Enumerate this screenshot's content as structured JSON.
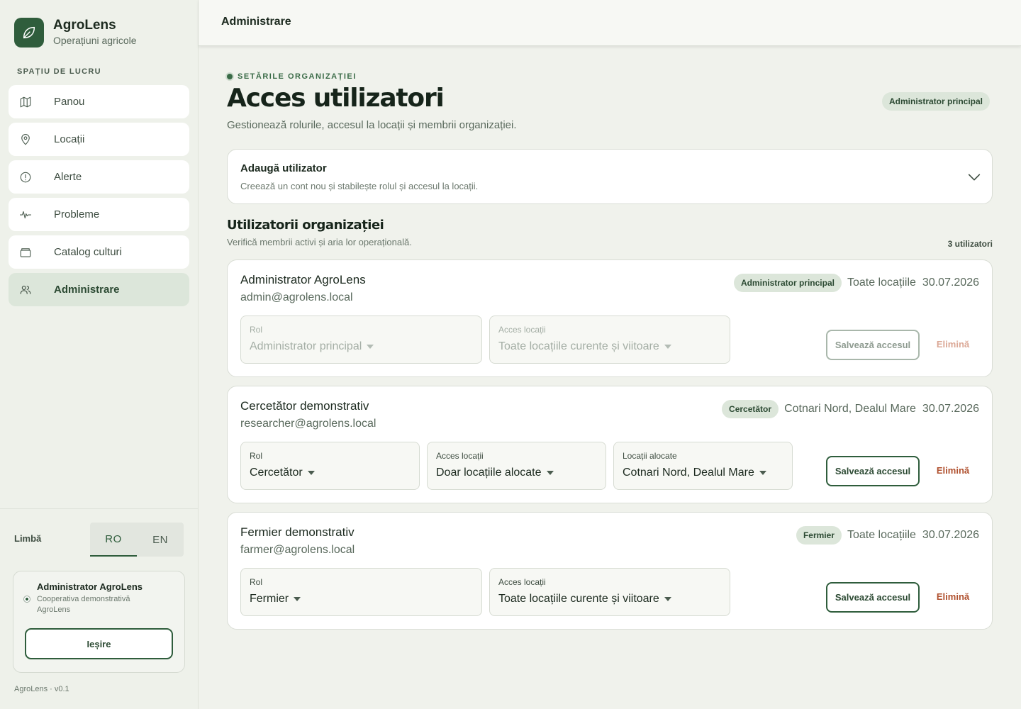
{
  "app": {
    "name": "AgroLens",
    "subtitle": "Operațiuni agricole",
    "version": "AgroLens · v0.1"
  },
  "sidebar": {
    "section_label": "SPAȚIU DE LUCRU",
    "items": [
      {
        "label": "Panou",
        "icon": "map-icon"
      },
      {
        "label": "Locații",
        "icon": "location-pin-icon"
      },
      {
        "label": "Alerte",
        "icon": "alert-circle-icon"
      },
      {
        "label": "Probleme",
        "icon": "activity-icon"
      },
      {
        "label": "Catalog culturi",
        "icon": "catalog-icon"
      },
      {
        "label": "Administrare",
        "icon": "users-icon",
        "active": true
      }
    ],
    "language": {
      "label": "Limbă",
      "options": [
        "RO",
        "EN"
      ],
      "selected": "RO"
    },
    "user": {
      "name": "Administrator AgroLens",
      "org": "Cooperativa demonstrativă AgroLens",
      "logout_label": "Ieșire"
    }
  },
  "topbar": {
    "title": "Administrare"
  },
  "page": {
    "eyebrow": "SETĂRILE ORGANIZAȚIEI",
    "title": "Acces utilizatori",
    "description": "Gestionează rolurile, accesul la locații și membrii organizației.",
    "role_badge": "Administrator principal"
  },
  "add_user": {
    "title": "Adaugă utilizator",
    "subtitle": "Creează un cont nou și stabilește rolul și accesul la locații."
  },
  "users_section": {
    "title": "Utilizatorii organizației",
    "subtitle": "Verifică membrii activi și aria lor operațională.",
    "count": "3 utilizatori"
  },
  "labels": {
    "role": "Rol",
    "location_access": "Acces locații",
    "assigned_locations": "Locații alocate",
    "save": "Salvează accesul",
    "remove": "Elimină"
  },
  "users": [
    {
      "name": "Administrator AgroLens",
      "email": "admin@agrolens.local",
      "badge": "Administrator principal",
      "locations": "Toate locațiile",
      "date": "30.07.2026",
      "role_value": "Administrator principal",
      "access_value": "Toate locațiile curente și viitoare",
      "disabled": true
    },
    {
      "name": "Cercetător demonstrativ",
      "email": "researcher@agrolens.local",
      "badge": "Cercetător",
      "locations": "Cotnari Nord, Dealul Mare",
      "date": "30.07.2026",
      "role_value": "Cercetător",
      "access_value": "Doar locațiile alocate",
      "assigned_value": "Cotnari Nord, Dealul Mare",
      "disabled": false
    },
    {
      "name": "Fermier demonstrativ",
      "email": "farmer@agrolens.local",
      "badge": "Fermier",
      "locations": "Toate locațiile",
      "date": "30.07.2026",
      "role_value": "Fermier",
      "access_value": "Toate locațiile curente și viitoare",
      "disabled": false
    }
  ],
  "colors": {
    "brand": "#2f5d3c",
    "danger": "#b0512f",
    "badge_bg": "#dce6da"
  }
}
